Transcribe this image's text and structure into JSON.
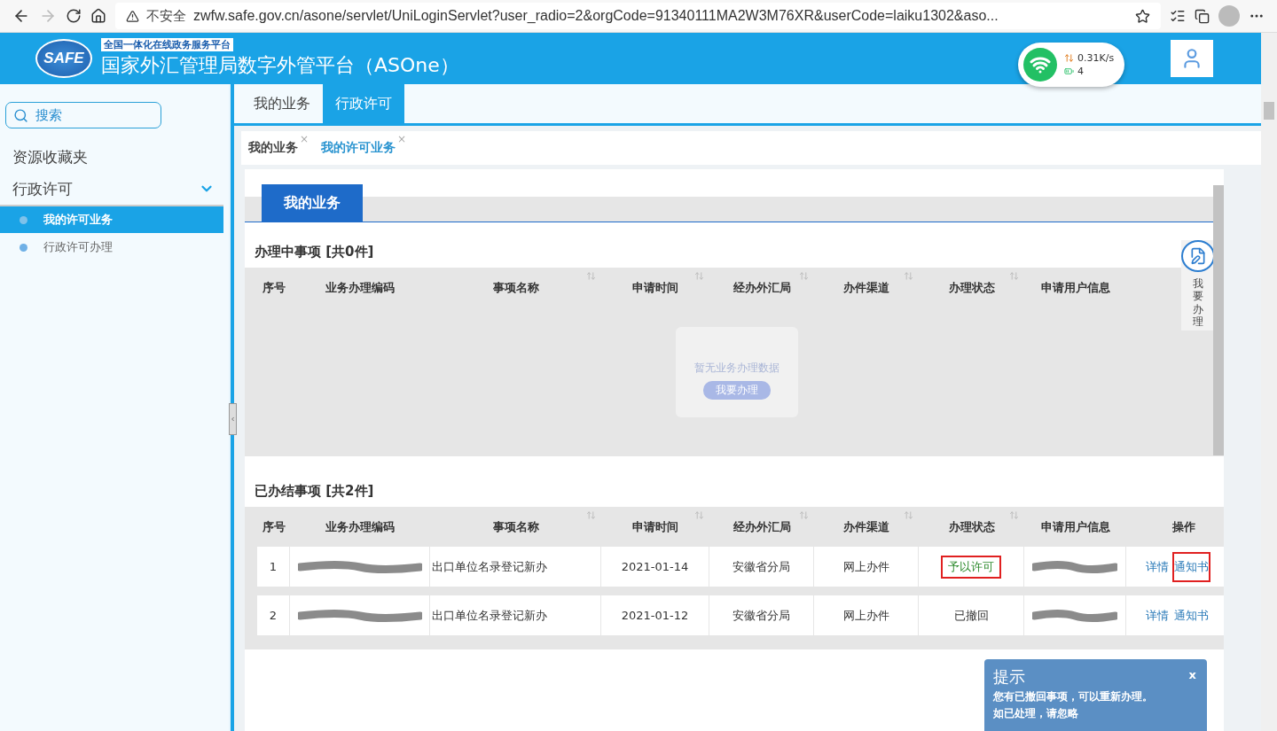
{
  "browser": {
    "security_label": "不安全",
    "url": "zwfw.safe.gov.cn/asone/servlet/UniLoginServlet?user_radio=2&orgCode=91340111MA2W3M76XR&userCode=laiku1302&aso..."
  },
  "header": {
    "logo_text": "SAFE",
    "subtitle": "全国一体化在线政务服务平台",
    "title": "国家外汇管理局数字外管平台（ASOne）"
  },
  "network_widget": {
    "speed": "0.31K/s",
    "count": "4"
  },
  "sidebar": {
    "search_label": "搜索",
    "items": [
      {
        "label": "资源收藏夹",
        "expanded": false
      },
      {
        "label": "行政许可",
        "expanded": true,
        "children": [
          {
            "label": "我的许可业务",
            "selected": true
          },
          {
            "label": "行政许可办理",
            "selected": false
          }
        ]
      }
    ]
  },
  "top_tabs": [
    {
      "label": "我的业务",
      "selected": false
    },
    {
      "label": "行政许可",
      "selected": true
    }
  ],
  "page_tabs": [
    {
      "label": "我的业务",
      "selected": false,
      "close": "×"
    },
    {
      "label": "我的许可业务",
      "selected": true,
      "close": "×"
    }
  ],
  "section_tab": "我的业务",
  "pending": {
    "title": "办理中事项 [共0件]",
    "columns": [
      {
        "label": "序号",
        "sortable": false
      },
      {
        "label": "业务办理编码",
        "sortable": false
      },
      {
        "label": "事项名称",
        "sortable": true
      },
      {
        "label": "申请时间",
        "sortable": true
      },
      {
        "label": "经办外汇局",
        "sortable": true
      },
      {
        "label": "办件渠道",
        "sortable": true
      },
      {
        "label": "办理状态",
        "sortable": true
      },
      {
        "label": "申请用户信息",
        "sortable": false
      }
    ],
    "empty_message": "暂无业务办理数据",
    "empty_button": "我要办理"
  },
  "float_button": "我要办理",
  "done": {
    "title": "已办结事项 [共2件]",
    "columns": [
      {
        "label": "序号",
        "sortable": false
      },
      {
        "label": "业务办理编码",
        "sortable": false
      },
      {
        "label": "事项名称",
        "sortable": true
      },
      {
        "label": "申请时间",
        "sortable": true
      },
      {
        "label": "经办外汇局",
        "sortable": true
      },
      {
        "label": "办件渠道",
        "sortable": true
      },
      {
        "label": "办理状态",
        "sortable": true
      },
      {
        "label": "申请用户信息",
        "sortable": false
      },
      {
        "label": "操作",
        "sortable": false
      }
    ],
    "rows": [
      {
        "index": "1",
        "code": {
          "kind": "redacted"
        },
        "name": "出口单位名录登记新办",
        "date": "2021-01-14",
        "bureau": "安徽省分局",
        "channel": "网上办件",
        "status": "予以许可",
        "status_highlighted": true,
        "user": {
          "kind": "redacted"
        },
        "actions": [
          {
            "label": "详情",
            "highlighted": false
          },
          {
            "label": "通知书",
            "highlighted": true
          }
        ]
      },
      {
        "index": "2",
        "code": {
          "kind": "redacted"
        },
        "name": "出口单位名录登记新办",
        "date": "2021-01-12",
        "bureau": "安徽省分局",
        "channel": "网上办件",
        "status": "已撤回",
        "status_highlighted": false,
        "user": {
          "kind": "redacted"
        },
        "actions": [
          {
            "label": "详情",
            "highlighted": false
          },
          {
            "label": "通知书",
            "highlighted": false
          }
        ]
      }
    ]
  },
  "notice": {
    "title": "提示",
    "close": "x",
    "message": "您有已撤回事项，可以重新办理。",
    "note": "如已处理，请忽略"
  }
}
